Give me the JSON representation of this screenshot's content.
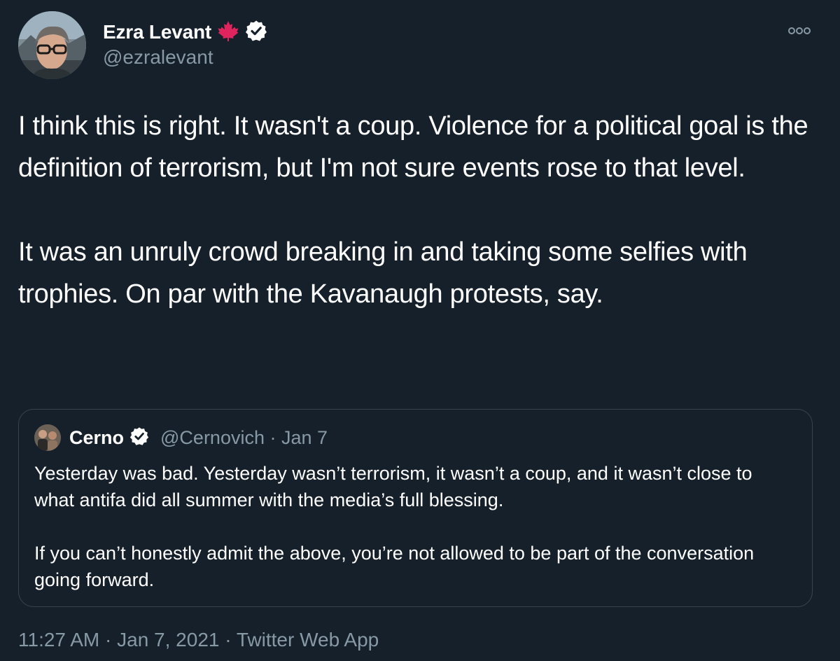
{
  "author": {
    "name": "Ezra Levant",
    "handle": "@ezralevant"
  },
  "tweet": {
    "paragraphs": [
      "I think this is right. It wasn't a coup. Violence for a political goal is the definition of terrorism, but I'm not sure events rose to that level.",
      "It was an unruly crowd breaking in and taking some selfies with trophies. On par with the Kavanaugh protests, say."
    ]
  },
  "quoted_tweet": {
    "name": "Cerno",
    "handle": "@Cernovich",
    "separator": "·",
    "date": "Jan 7",
    "paragraphs": [
      "Yesterday was bad. Yesterday wasn’t terrorism, it wasn’t a coup, and it wasn’t close to what antifa did all summer with the media’s full blessing.",
      "If you can’t honestly admit the above, you’re not allowed to be part of the conversation going forward."
    ]
  },
  "footer": {
    "time": "11:27 AM",
    "date": "Jan 7, 2021",
    "source": "Twitter Web App",
    "separator": "·"
  },
  "icons": {
    "maple_leaf": "maple-leaf-icon",
    "verified": "verified-badge-icon",
    "more": "more-options-icon"
  },
  "colors": {
    "background": "#15202b",
    "text": "#ffffff",
    "secondary_text": "#8899a6",
    "border": "#38444d",
    "maple_leaf": "#e0245e"
  }
}
